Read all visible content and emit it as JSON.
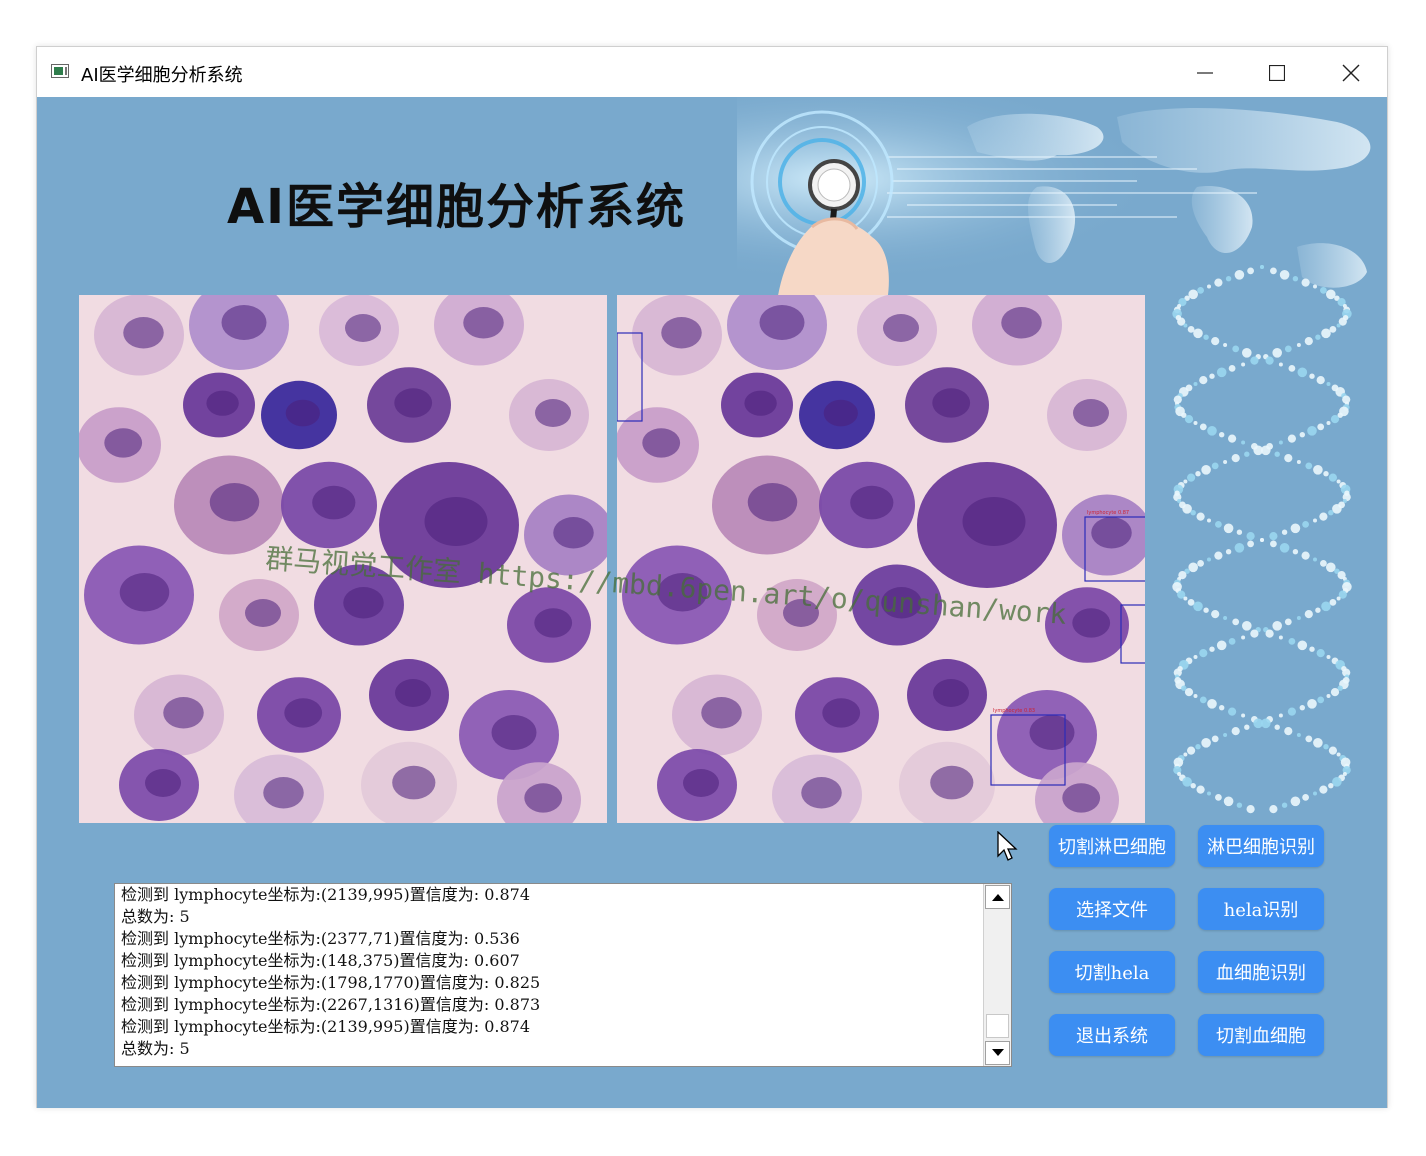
{
  "window": {
    "title": "AI医学细胞分析系统"
  },
  "header": {
    "title": "AI医学细胞分析系统"
  },
  "watermark": {
    "text": "群马视觉工作室 https://mbd.6pen.art/o/qunshan/work"
  },
  "images": {
    "left": {
      "label": "original-cell-image"
    },
    "right": {
      "label": "detected-cell-image"
    }
  },
  "log": {
    "lines": [
      "检测到 lymphocyte坐标为:(2139,995)置信度为: 0.874",
      "总数为: 5",
      "检测到 lymphocyte坐标为:(2377,71)置信度为: 0.536",
      "检测到 lymphocyte坐标为:(148,375)置信度为: 0.607",
      "检测到 lymphocyte坐标为:(1798,1770)置信度为: 0.825",
      "检测到 lymphocyte坐标为:(2267,1316)置信度为: 0.873",
      "检测到 lymphocyte坐标为:(2139,995)置信度为: 0.874",
      "总数为: 5"
    ]
  },
  "buttons": {
    "cut_lymph": "切割淋巴细胞",
    "lymph_recognize": "淋巴细胞识别",
    "select_file": "选择文件",
    "hela_recognize": "hela识别",
    "cut_hela": "切割hela",
    "blood_recognize": "血细胞识别",
    "exit": "退出系统",
    "cut_blood": "切割血细胞"
  },
  "colors": {
    "background": "#79a9cd",
    "button": "#3c8ef2",
    "button_text": "#ffffff",
    "detection_box": "#2b2bb8"
  }
}
